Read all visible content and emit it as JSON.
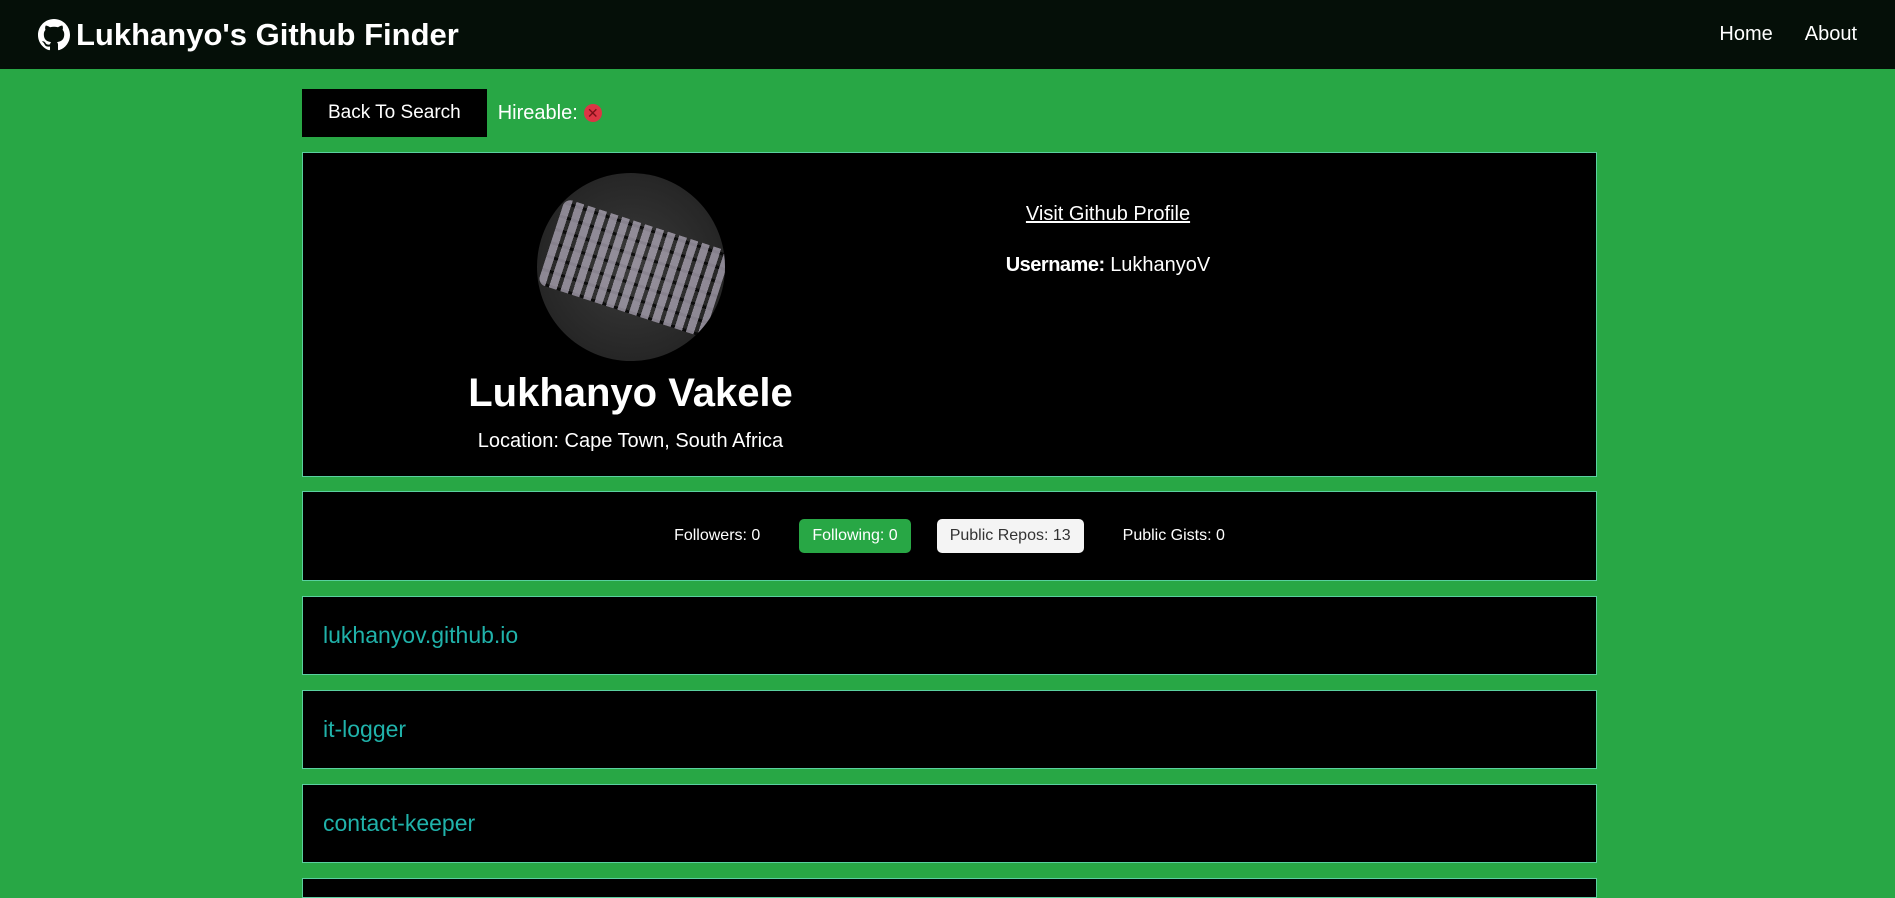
{
  "nav": {
    "brand": "Lukhanyo's Github Finder",
    "brand_icon": "github-icon",
    "links": [
      "Home",
      "About"
    ]
  },
  "topbar": {
    "back_label": "Back To Search",
    "hireable_label": "Hireable:",
    "hireable_icon": "times-circle-icon",
    "hireable_value": false
  },
  "profile": {
    "name": "Lukhanyo Vakele",
    "location": "Location: Cape Town, South Africa",
    "visit_label": "Visit Github Profile",
    "username_label": "Username:",
    "username_value": "LukhanyoV",
    "avatar": "keyboard-photo"
  },
  "stats": {
    "followers": "Followers: 0",
    "following": "Following: 0",
    "public_repos": "Public Repos: 13",
    "public_gists": "Public Gists: 0"
  },
  "repos": [
    "lukhanyov.github.io",
    "it-logger",
    "contact-keeper"
  ],
  "colors": {
    "page_bg": "#28a745",
    "navbar_bg": "#050f08",
    "card_bg": "#000000",
    "repo_link": "#20b2aa",
    "danger": "#dc3545"
  }
}
